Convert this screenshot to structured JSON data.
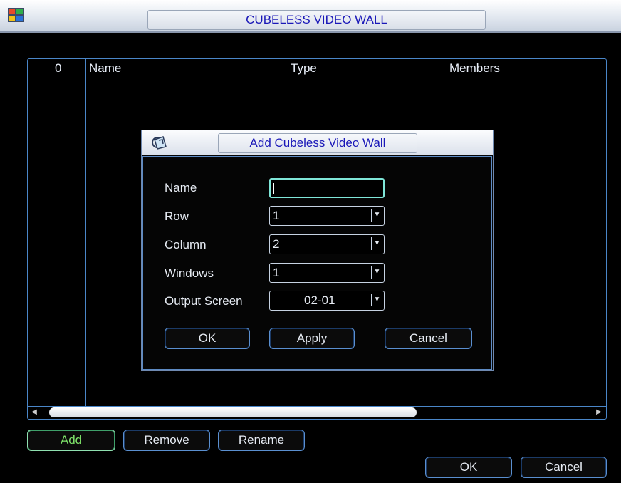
{
  "window": {
    "title": "CUBELESS VIDEO WALL"
  },
  "table": {
    "headers": {
      "index": "0",
      "name": "Name",
      "type": "Type",
      "members": "Members"
    }
  },
  "bottom_buttons": {
    "add": "Add",
    "remove": "Remove",
    "rename": "Rename",
    "ok": "OK",
    "cancel": "Cancel"
  },
  "dialog": {
    "title": "Add Cubeless Video Wall",
    "fields": {
      "name_label": "Name",
      "name_value": "",
      "row_label": "Row",
      "row_value": "1",
      "column_label": "Column",
      "column_value": "2",
      "windows_label": "Windows",
      "windows_value": "1",
      "output_label": "Output Screen",
      "output_value": "02-01"
    },
    "buttons": {
      "ok": "OK",
      "apply": "Apply",
      "cancel": "Cancel"
    }
  },
  "colors": {
    "accent": "#1a18b8",
    "border": "#4a86c8",
    "add_text": "#7ee36a"
  }
}
